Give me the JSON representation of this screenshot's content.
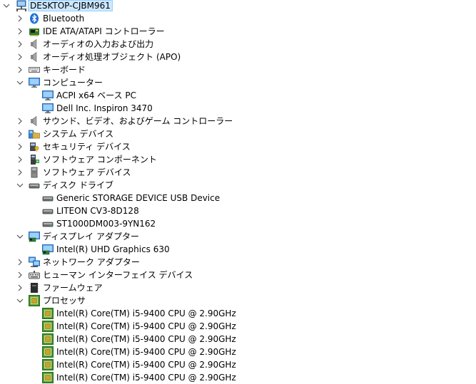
{
  "tree": {
    "root": {
      "label": "DESKTOP-CJBM961",
      "icon": "computer-network-icon",
      "expanded": true
    },
    "nodes": [
      {
        "label": "Bluetooth",
        "icon": "bluetooth-icon",
        "expanded": false
      },
      {
        "label": "IDE ATA/ATAPI コントローラー",
        "icon": "ide-controller-icon",
        "expanded": false
      },
      {
        "label": "オーディオの入力および出力",
        "icon": "speaker-icon",
        "expanded": false
      },
      {
        "label": "オーディオ処理オブジェクト (APO)",
        "icon": "speaker-icon",
        "expanded": false
      },
      {
        "label": "キーボード",
        "icon": "keyboard-icon",
        "expanded": false
      },
      {
        "label": "コンピューター",
        "icon": "monitor-icon",
        "expanded": true,
        "children": [
          {
            "label": "ACPI x64 ベース PC",
            "icon": "monitor-icon"
          },
          {
            "label": "Dell Inc. Inspiron 3470",
            "icon": "monitor-icon"
          }
        ]
      },
      {
        "label": "サウンド、ビデオ、およびゲーム コントローラー",
        "icon": "speaker-icon",
        "expanded": false
      },
      {
        "label": "システム デバイス",
        "icon": "system-folder-icon",
        "expanded": false
      },
      {
        "label": "セキュリティ デバイス",
        "icon": "security-key-icon",
        "expanded": false
      },
      {
        "label": "ソフトウェア コンポーネント",
        "icon": "software-component-icon",
        "expanded": false
      },
      {
        "label": "ソフトウェア デバイス",
        "icon": "software-device-icon",
        "expanded": false
      },
      {
        "label": "ディスク ドライブ",
        "icon": "disk-drive-icon",
        "expanded": true,
        "children": [
          {
            "label": "Generic STORAGE DEVICE USB Device",
            "icon": "disk-drive-icon"
          },
          {
            "label": "LITEON CV3-8D128",
            "icon": "disk-drive-icon"
          },
          {
            "label": "ST1000DM003-9YN162",
            "icon": "disk-drive-icon"
          }
        ]
      },
      {
        "label": "ディスプレイ アダプター",
        "icon": "display-adapter-icon",
        "expanded": true,
        "children": [
          {
            "label": "Intel(R) UHD Graphics 630",
            "icon": "display-adapter-icon"
          }
        ]
      },
      {
        "label": "ネットワーク アダプター",
        "icon": "network-adapter-icon",
        "expanded": false
      },
      {
        "label": "ヒューマン インターフェイス デバイス",
        "icon": "hid-icon",
        "expanded": false
      },
      {
        "label": "ファームウェア",
        "icon": "firmware-icon",
        "expanded": false
      },
      {
        "label": "プロセッサ",
        "icon": "processor-icon",
        "expanded": true,
        "children": [
          {
            "label": "Intel(R) Core(TM) i5-9400 CPU @ 2.90GHz",
            "icon": "processor-icon"
          },
          {
            "label": "Intel(R) Core(TM) i5-9400 CPU @ 2.90GHz",
            "icon": "processor-icon"
          },
          {
            "label": "Intel(R) Core(TM) i5-9400 CPU @ 2.90GHz",
            "icon": "processor-icon"
          },
          {
            "label": "Intel(R) Core(TM) i5-9400 CPU @ 2.90GHz",
            "icon": "processor-icon"
          },
          {
            "label": "Intel(R) Core(TM) i5-9400 CPU @ 2.90GHz",
            "icon": "processor-icon"
          },
          {
            "label": "Intel(R) Core(TM) i5-9400 CPU @ 2.90GHz",
            "icon": "processor-icon"
          }
        ]
      }
    ]
  }
}
